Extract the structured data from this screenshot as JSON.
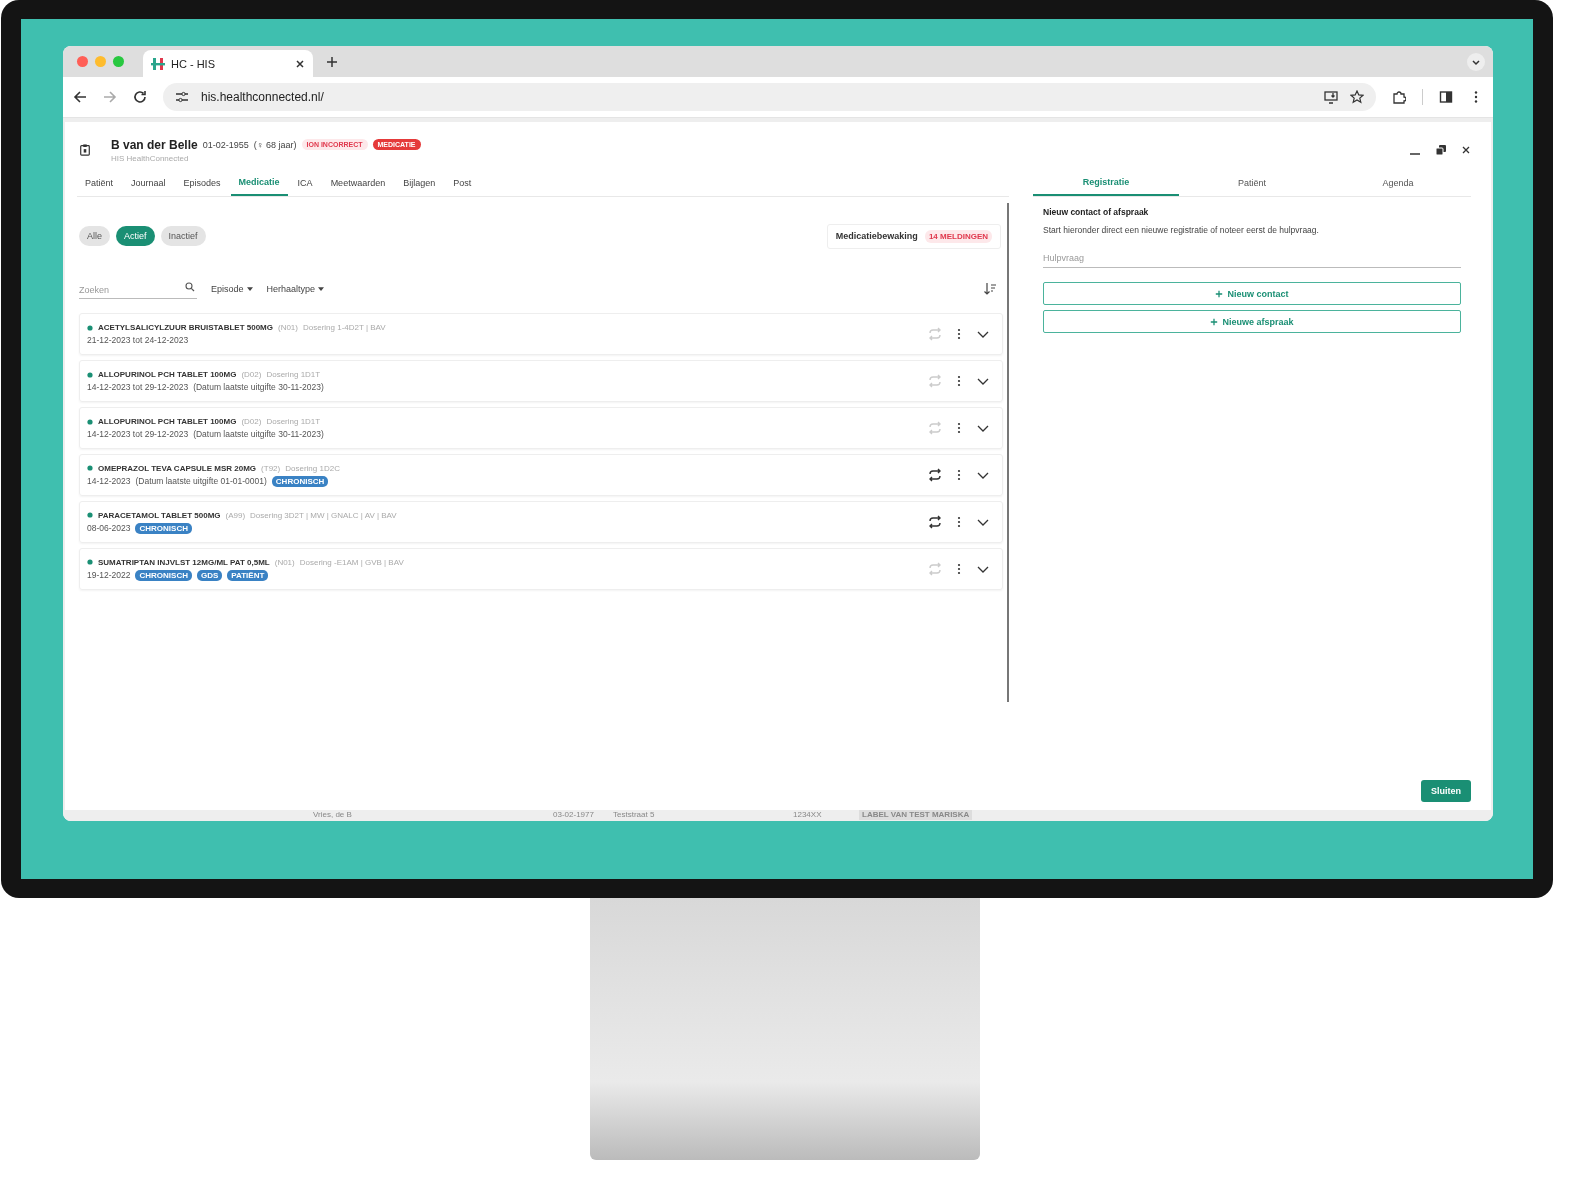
{
  "browser": {
    "tab_title": "HC - HIS",
    "url": "his.healthconnected.nl/"
  },
  "patient": {
    "name": "B van der Belle",
    "birth": "01-02-1955",
    "age": "(♀ 68 jaar)",
    "subtitle": "HIS HealthConnected",
    "badges": [
      {
        "label": "ION INCORRECT",
        "kind": "soft"
      },
      {
        "label": "MEDICATIE",
        "kind": "solid"
      }
    ]
  },
  "tabs": [
    {
      "label": "Patiënt",
      "selected": false
    },
    {
      "label": "Journaal",
      "selected": false
    },
    {
      "label": "Episodes",
      "selected": false
    },
    {
      "label": "Medicatie",
      "selected": true
    },
    {
      "label": "ICA",
      "selected": false
    },
    {
      "label": "Meetwaarden",
      "selected": false
    },
    {
      "label": "Bijlagen",
      "selected": false
    },
    {
      "label": "Post",
      "selected": false
    }
  ],
  "filters": [
    {
      "label": "Alle",
      "selected": false
    },
    {
      "label": "Actief",
      "selected": true
    },
    {
      "label": "Inactief",
      "selected": false
    }
  ],
  "monitoring": {
    "label": "Medicatiebewaking",
    "badge": "14 MELDINGEN"
  },
  "search": {
    "placeholder": "Zoeken"
  },
  "dropdowns": [
    "Episode",
    "Herhaaltype"
  ],
  "medications": [
    {
      "name": "ACETYLSALICYLZUUR BRUISTABLET 500MG",
      "code": "(N01)",
      "dosage": "Dosering 1-4D2T | BAV",
      "period": "21-12-2023 tot 24-12-2023",
      "repeat": false
    },
    {
      "name": "ALLOPURINOL PCH TABLET 100MG",
      "code": "(D02)",
      "dosage": "Dosering 1D1T",
      "period": "14-12-2023 tot 29-12-2023",
      "note": "(Datum laatste uitgifte 30-11-2023)",
      "repeat": false
    },
    {
      "name": "ALLOPURINOL PCH TABLET 100MG",
      "code": "(D02)",
      "dosage": "Dosering 1D1T",
      "period": "14-12-2023 tot 29-12-2023",
      "note": "(Datum laatste uitgifte 30-11-2023)",
      "repeat": false
    },
    {
      "name": "OMEPRAZOL TEVA CAPSULE MSR 20MG",
      "code": "(T92)",
      "dosage": "Dosering 1D2C",
      "period": "14-12-2023",
      "note": "(Datum laatste uitgifte 01-01-0001)",
      "tags": [
        "CHRONISCH"
      ],
      "repeat": true
    },
    {
      "name": "PARACETAMOL TABLET 500MG",
      "code": "(A99)",
      "dosage": "Dosering 3D2T | MW | GNALC | AV | BAV",
      "period": "08-06-2023",
      "tags": [
        "CHRONISCH"
      ],
      "repeat": true
    },
    {
      "name": "SUMATRIPTAN INJVLST 12MG/ML PAT 0,5ML",
      "code": "(N01)",
      "dosage": "Dosering -E1AM | GVB | BAV",
      "period": "19-12-2022",
      "tags": [
        "CHRONISCH",
        "GDS",
        "PATIËNT"
      ],
      "repeat": false
    }
  ],
  "side_tabs": [
    {
      "label": "Registratie",
      "selected": true
    },
    {
      "label": "Patiënt",
      "selected": false
    },
    {
      "label": "Agenda",
      "selected": false
    }
  ],
  "registration": {
    "heading": "Nieuw contact of afspraak",
    "text": "Start hieronder direct een nieuwe registratie of noteer eerst de hulpvraag.",
    "placeholder": "Hulpvraag",
    "buttons": [
      "Nieuw contact",
      "Nieuwe afspraak"
    ]
  },
  "close_button": "Sluiten",
  "background_row": [
    "Vries, de B",
    "03-02-1977",
    "Teststraat 5",
    "1234XX",
    "LABEL VAN TEST MARISKA"
  ]
}
